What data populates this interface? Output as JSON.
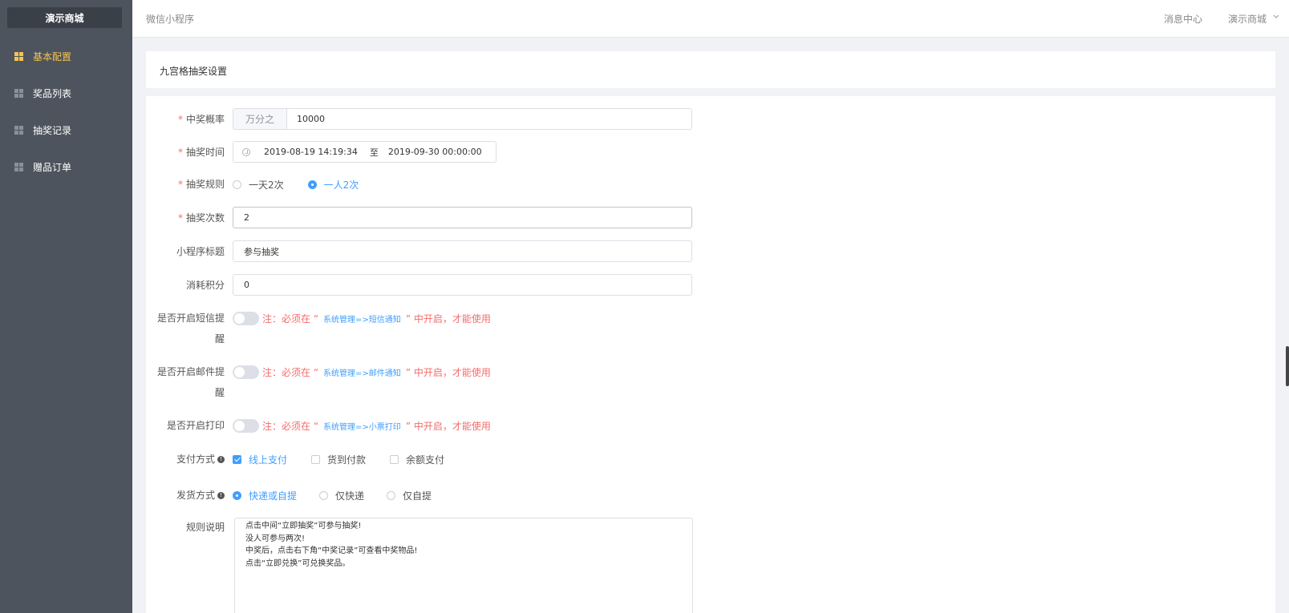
{
  "sidebar": {
    "brand": "演示商城",
    "items": [
      {
        "label": "基本配置",
        "active": true
      },
      {
        "label": "奖品列表",
        "active": false
      },
      {
        "label": "抽奖记录",
        "active": false
      },
      {
        "label": "赠品订单",
        "active": false
      }
    ]
  },
  "topbar": {
    "crumb": "微信小程序",
    "messages": "消息中心",
    "shop": "演示商城"
  },
  "panel": {
    "title": "九宫格抽奖设置"
  },
  "form": {
    "probability": {
      "label": "中奖概率",
      "prepend": "万分之",
      "value": "10000"
    },
    "time": {
      "label": "抽奖时间",
      "start": "2019-08-19 14:19:34",
      "separator": "至",
      "end": "2019-09-30 00:00:00"
    },
    "rule": {
      "label": "抽奖规则",
      "options": [
        "一天2次",
        "一人2次"
      ],
      "selected": "一人2次"
    },
    "count": {
      "label": "抽奖次数",
      "value": "2"
    },
    "mini_title": {
      "label": "小程序标题",
      "value": "参与抽奖"
    },
    "points": {
      "label": "消耗积分",
      "value": "0"
    },
    "sms": {
      "label_line1": "是否开启短信提",
      "label_line2": "醒",
      "note_prefix": "注：必须在 “",
      "note_link": "系统管理=>短信通知",
      "note_suffix": "” 中开启，才能使用",
      "on": false
    },
    "mail": {
      "label_line1": "是否开启邮件提",
      "label_line2": "醒",
      "note_prefix": "注：必须在 “",
      "note_link": "系统管理=>邮件通知",
      "note_suffix": "” 中开启，才能使用",
      "on": false
    },
    "print": {
      "label": "是否开启打印",
      "note_prefix": "注：必须在 “",
      "note_link": "系统管理=>小票打印",
      "note_suffix": "” 中开启，才能使用",
      "on": false
    },
    "payment": {
      "label": "支付方式",
      "options": [
        "线上支付",
        "货到付款",
        "余额支付"
      ],
      "checked": [
        "线上支付"
      ]
    },
    "delivery": {
      "label": "发货方式",
      "options": [
        "快递或自提",
        "仅快递",
        "仅自提"
      ],
      "selected": "快递或自提"
    },
    "rules_text": {
      "label": "规则说明",
      "lines": [
        "点击中间“立即抽奖”可参与抽奖!",
        "没人可参与两次!",
        "中奖后，点击右下角“中奖记录”可查看中奖物品!",
        "点击“立即兑换”可兑换奖品。"
      ]
    }
  },
  "colors": {
    "sidebar_bg": "#4d545d",
    "active": "#f5c44f",
    "primary": "#409eff",
    "danger": "#f56c6c"
  }
}
